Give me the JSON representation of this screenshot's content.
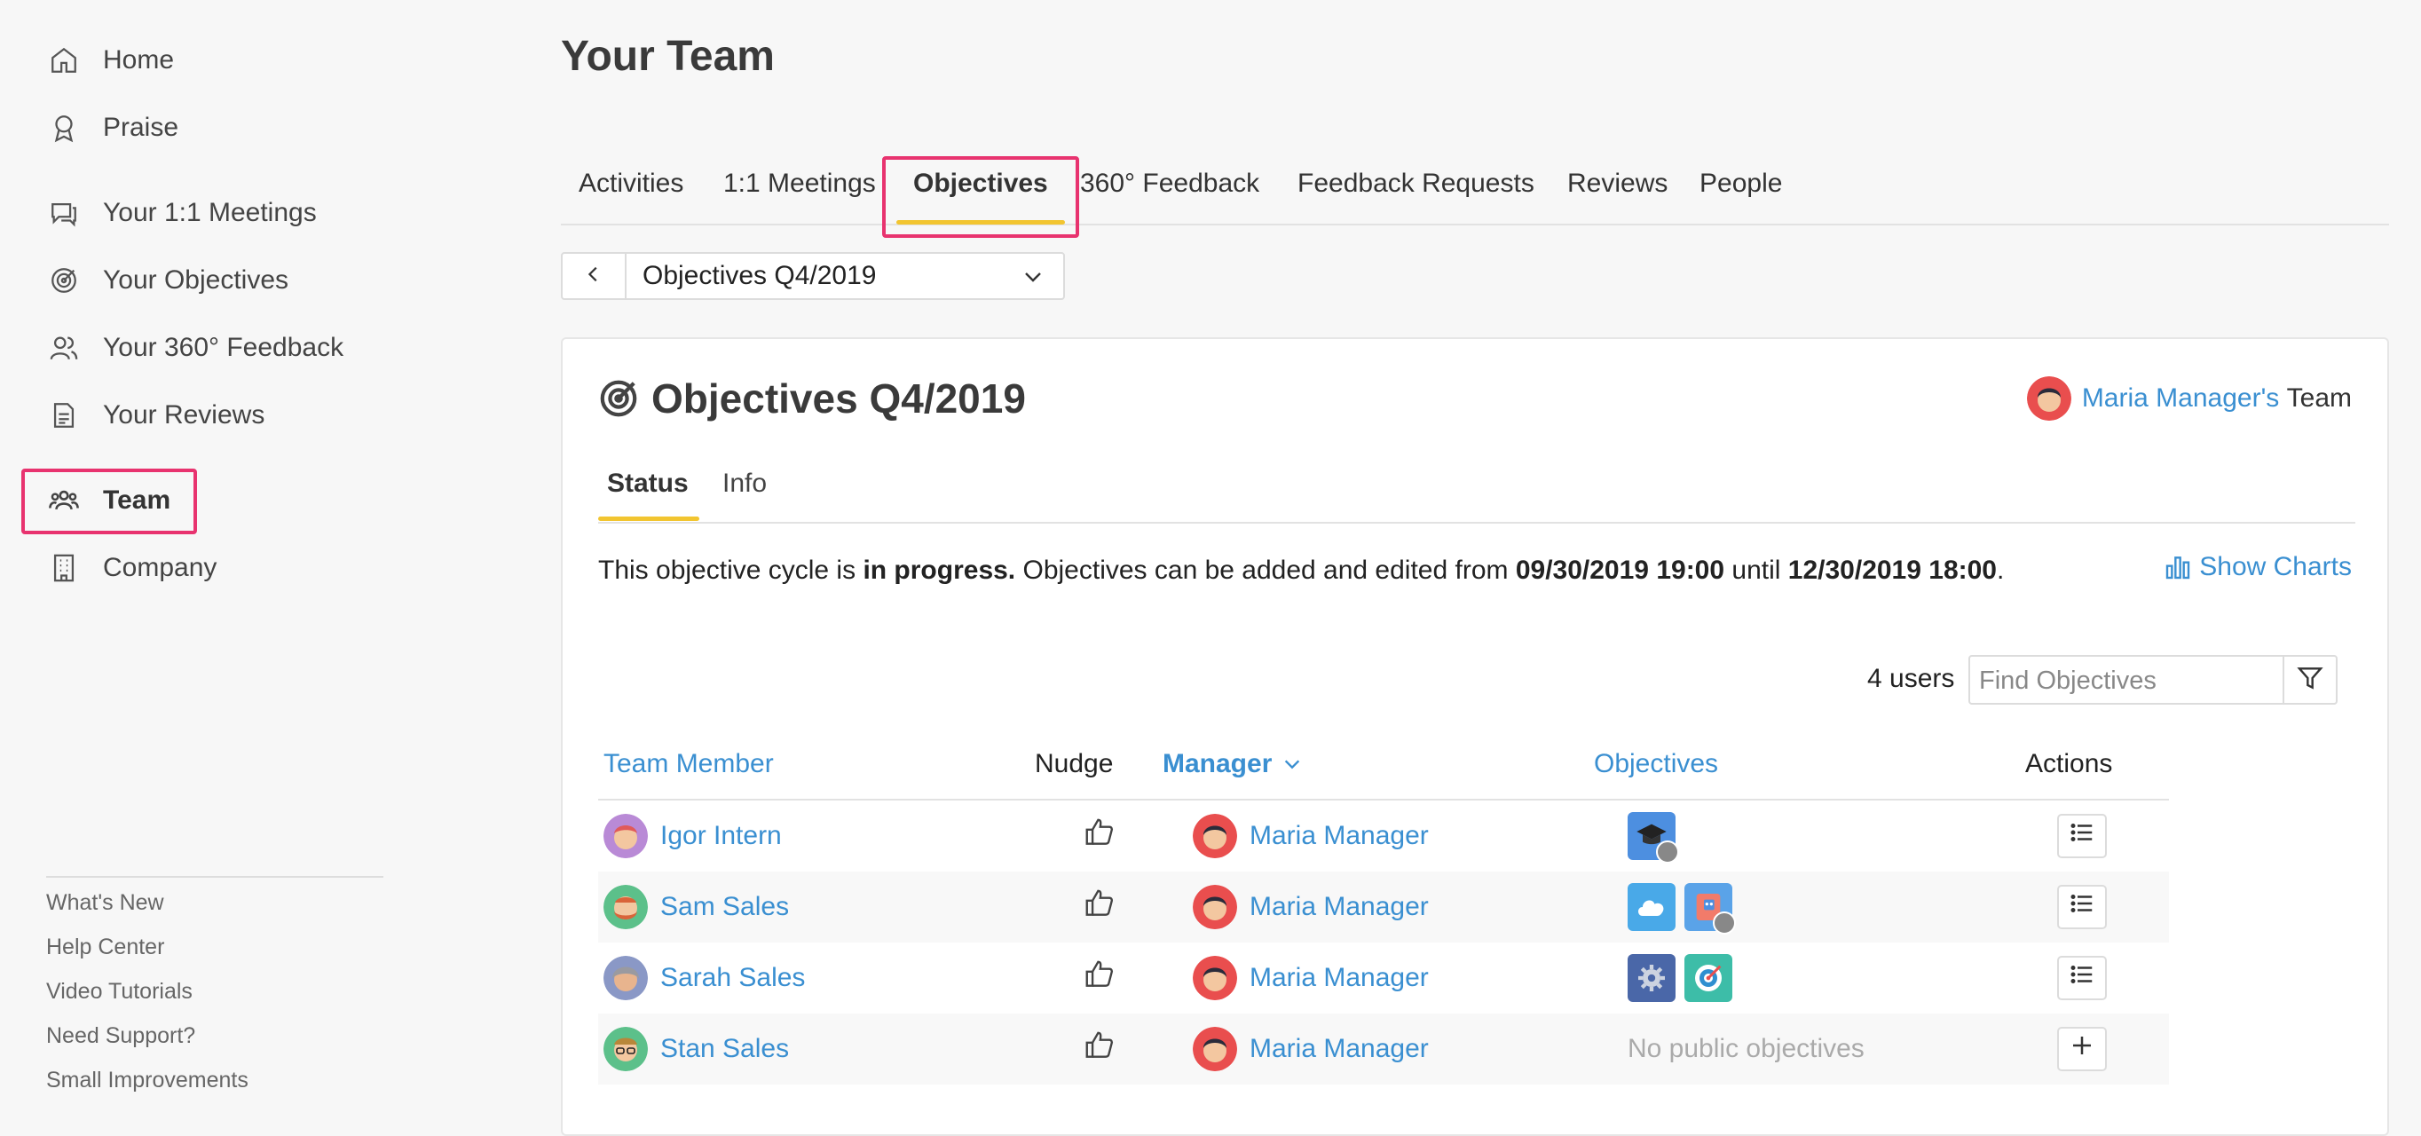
{
  "sidebar": {
    "items": [
      {
        "label": "Home",
        "icon": "home-icon"
      },
      {
        "label": "Praise",
        "icon": "award-icon"
      },
      {
        "label": "Your 1:1 Meetings",
        "icon": "chat-icon"
      },
      {
        "label": "Your Objectives",
        "icon": "target-icon"
      },
      {
        "label": "Your 360° Feedback",
        "icon": "people-icon"
      },
      {
        "label": "Your Reviews",
        "icon": "document-icon"
      },
      {
        "label": "Team",
        "icon": "team-icon",
        "active": true
      },
      {
        "label": "Company",
        "icon": "building-icon"
      }
    ],
    "footer": [
      "What's New",
      "Help Center",
      "Video Tutorials",
      "Need Support?",
      "Small Improvements"
    ]
  },
  "page": {
    "title": "Your Team"
  },
  "tabs": [
    "Activities",
    "1:1 Meetings",
    "Objectives",
    "360° Feedback",
    "Feedback Requests",
    "Reviews",
    "People"
  ],
  "active_tab": "Objectives",
  "cycle_select": {
    "value": "Objectives Q4/2019"
  },
  "card": {
    "title": "Objectives Q4/2019",
    "team_owner": "Maria Manager's",
    "team_suffix": "Team",
    "subtabs": [
      "Status",
      "Info"
    ],
    "status": {
      "p1": "This objective cycle is ",
      "b1": "in progress.",
      "p2": " Objectives can be added and edited from ",
      "b2": "09/30/2019 19:00",
      "p3": " until ",
      "b3": "12/30/2019 18:00",
      "p4": "."
    },
    "show_charts": "Show Charts",
    "users_count": "4 users",
    "find_placeholder": "Find Objectives",
    "columns": {
      "member": "Team Member",
      "nudge": "Nudge",
      "manager": "Manager",
      "objectives": "Objectives",
      "actions": "Actions"
    },
    "rows": [
      {
        "member": "Igor Intern",
        "manager": "Maria Manager",
        "objectives": [
          "graduation-cap-icon"
        ],
        "locked": [
          true
        ],
        "no_objectives": "",
        "action": "list"
      },
      {
        "member": "Sam Sales",
        "manager": "Maria Manager",
        "objectives": [
          "cloud-icon",
          "robot-icon"
        ],
        "locked": [
          false,
          true
        ],
        "no_objectives": "",
        "action": "list"
      },
      {
        "member": "Sarah Sales",
        "manager": "Maria Manager",
        "objectives": [
          "gear-icon",
          "target-icon"
        ],
        "locked": [
          false,
          false
        ],
        "no_objectives": "",
        "action": "list"
      },
      {
        "member": "Stan Sales",
        "manager": "Maria Manager",
        "objectives": [],
        "locked": [],
        "no_objectives": "No public objectives",
        "action": "add"
      }
    ]
  },
  "colors": {
    "accent": "#3a8fd1",
    "highlight": "#e8336f",
    "underline": "#f2c530"
  }
}
